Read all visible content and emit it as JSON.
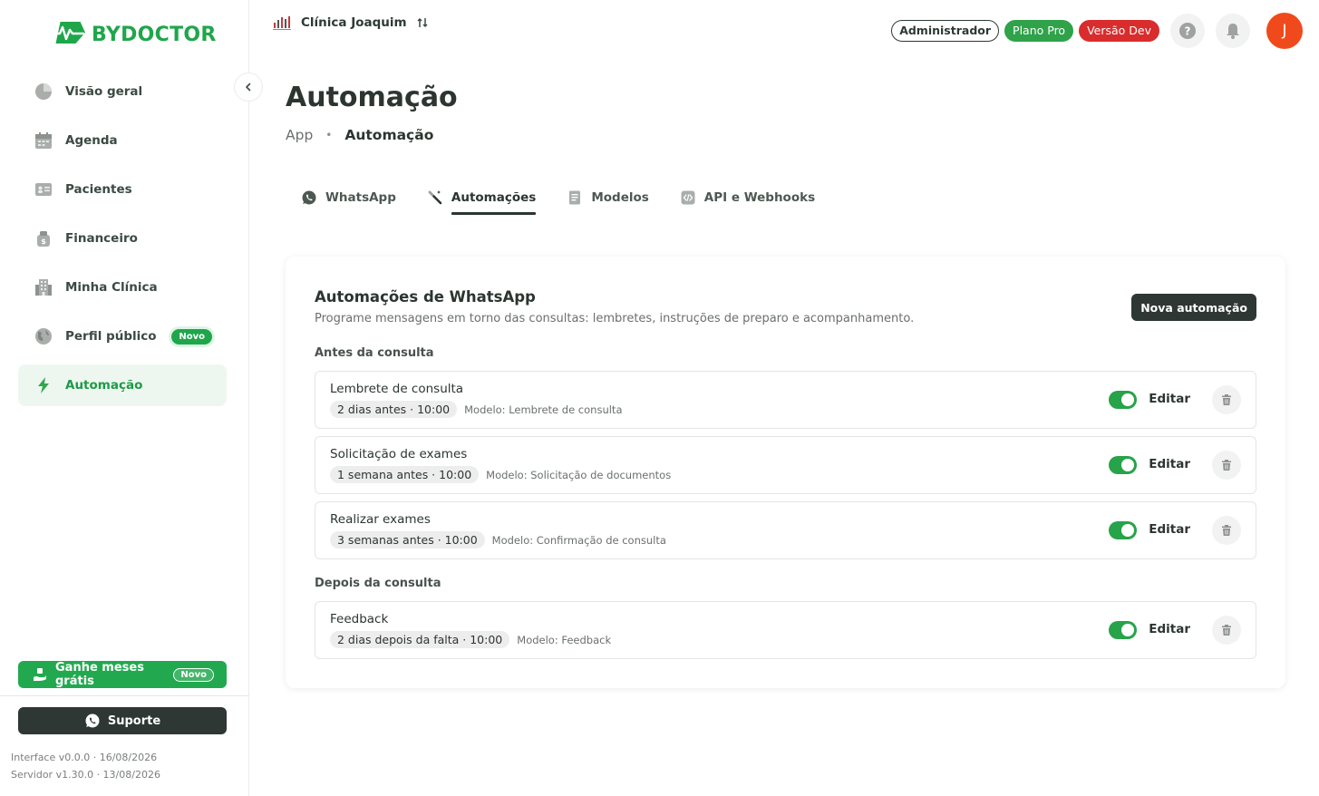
{
  "brand": {
    "name": "BYDOCTOR",
    "color": "#1fa64b"
  },
  "sidebar": {
    "items": [
      {
        "label": "Visão geral",
        "icon": "pie-chart-icon"
      },
      {
        "label": "Agenda",
        "icon": "calendar-icon"
      },
      {
        "label": "Pacientes",
        "icon": "id-card-icon"
      },
      {
        "label": "Financeiro",
        "icon": "money-bag-icon"
      },
      {
        "label": "Minha Clínica",
        "icon": "building-icon"
      },
      {
        "label": "Perfil público",
        "icon": "globe-icon",
        "badge": "Novo"
      },
      {
        "label": "Automação",
        "icon": "lightning-icon",
        "active": true
      }
    ],
    "promo": {
      "label": "Ganhe meses grátis",
      "badge": "Novo"
    },
    "support": {
      "label": "Suporte"
    },
    "version_interface": "Interface v0.0.0 · 16/08/2026",
    "version_server": "Servidor v1.30.0 · 13/08/2026"
  },
  "topbar": {
    "clinic_name": "Clínica Joaquim",
    "role": "Administrador",
    "plan": "Plano Pro",
    "env": "Versão Dev",
    "avatar_initial": "J"
  },
  "header": {
    "title": "Automação",
    "breadcrumb_app": "App",
    "breadcrumb_sep": "•",
    "breadcrumb_current": "Automação"
  },
  "tabs": [
    {
      "label": "WhatsApp",
      "icon": "whatsapp-icon"
    },
    {
      "label": "Automações",
      "icon": "magic-wand-icon",
      "active": true
    },
    {
      "label": "Modelos",
      "icon": "document-icon"
    },
    {
      "label": "API e Webhooks",
      "icon": "code-icon"
    }
  ],
  "card": {
    "title": "Automações de WhatsApp",
    "subtitle": "Programe mensagens em torno das consultas: lembretes, instruções de preparo e acompanhamento.",
    "new_button": "Nova automação",
    "edit_label": "Editar",
    "section_before": "Antes da consulta",
    "section_after": "Depois da consulta",
    "before": [
      {
        "title": "Lembrete de consulta",
        "timing": "2 dias antes · 10:00",
        "model": "Modelo: Lembrete de consulta",
        "enabled": true
      },
      {
        "title": "Solicitação de exames",
        "timing": "1 semana antes · 10:00",
        "model": "Modelo: Solicitação de documentos",
        "enabled": true
      },
      {
        "title": "Realizar exames",
        "timing": "3 semanas antes · 10:00",
        "model": "Modelo: Confirmação de consulta",
        "enabled": true
      }
    ],
    "after": [
      {
        "title": "Feedback",
        "timing": "2 dias depois da falta · 10:00",
        "model": "Modelo: Feedback",
        "enabled": true
      }
    ]
  },
  "colors": {
    "accent": "#1fa64b",
    "dark_button": "#2e3733",
    "danger": "#d92c2c",
    "avatar": "#f04a1c"
  }
}
